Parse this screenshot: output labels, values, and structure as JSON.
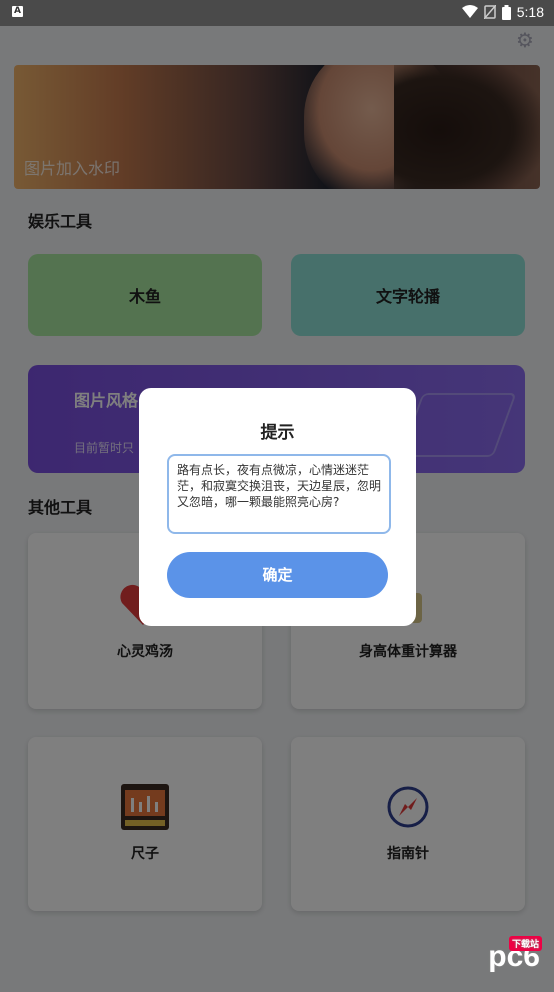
{
  "status_bar": {
    "time": "5:18",
    "app_icon_letter": "A"
  },
  "banner": {
    "label": "图片加入水印"
  },
  "sections": {
    "entertainment": "娱乐工具",
    "other": "其他工具"
  },
  "entertainment_tools": {
    "wooden_fish": "木鱼",
    "text_carousel": "文字轮播",
    "image_style": "图片风格",
    "image_style_sub": "目前暂时只"
  },
  "other_tools": {
    "soul_soup": "心灵鸡汤",
    "bmi": "身高体重计算器",
    "ruler": "尺子",
    "compass": "指南针"
  },
  "dialog": {
    "title": "提示",
    "message": "路有点长，夜有点微凉，心情迷迷茫茫，和寂寞交换沮丧，天边星辰，忽明又忽暗，哪一颗最能照亮心房?",
    "ok": "确定"
  },
  "watermark": {
    "logo": "pc6",
    "tag": "下载站"
  },
  "colors": {
    "accent": "#5b93e8",
    "green_tile": "#a8e6a0",
    "teal_tile": "#8fe0d6",
    "purple_tile": "#7a4fe0"
  }
}
